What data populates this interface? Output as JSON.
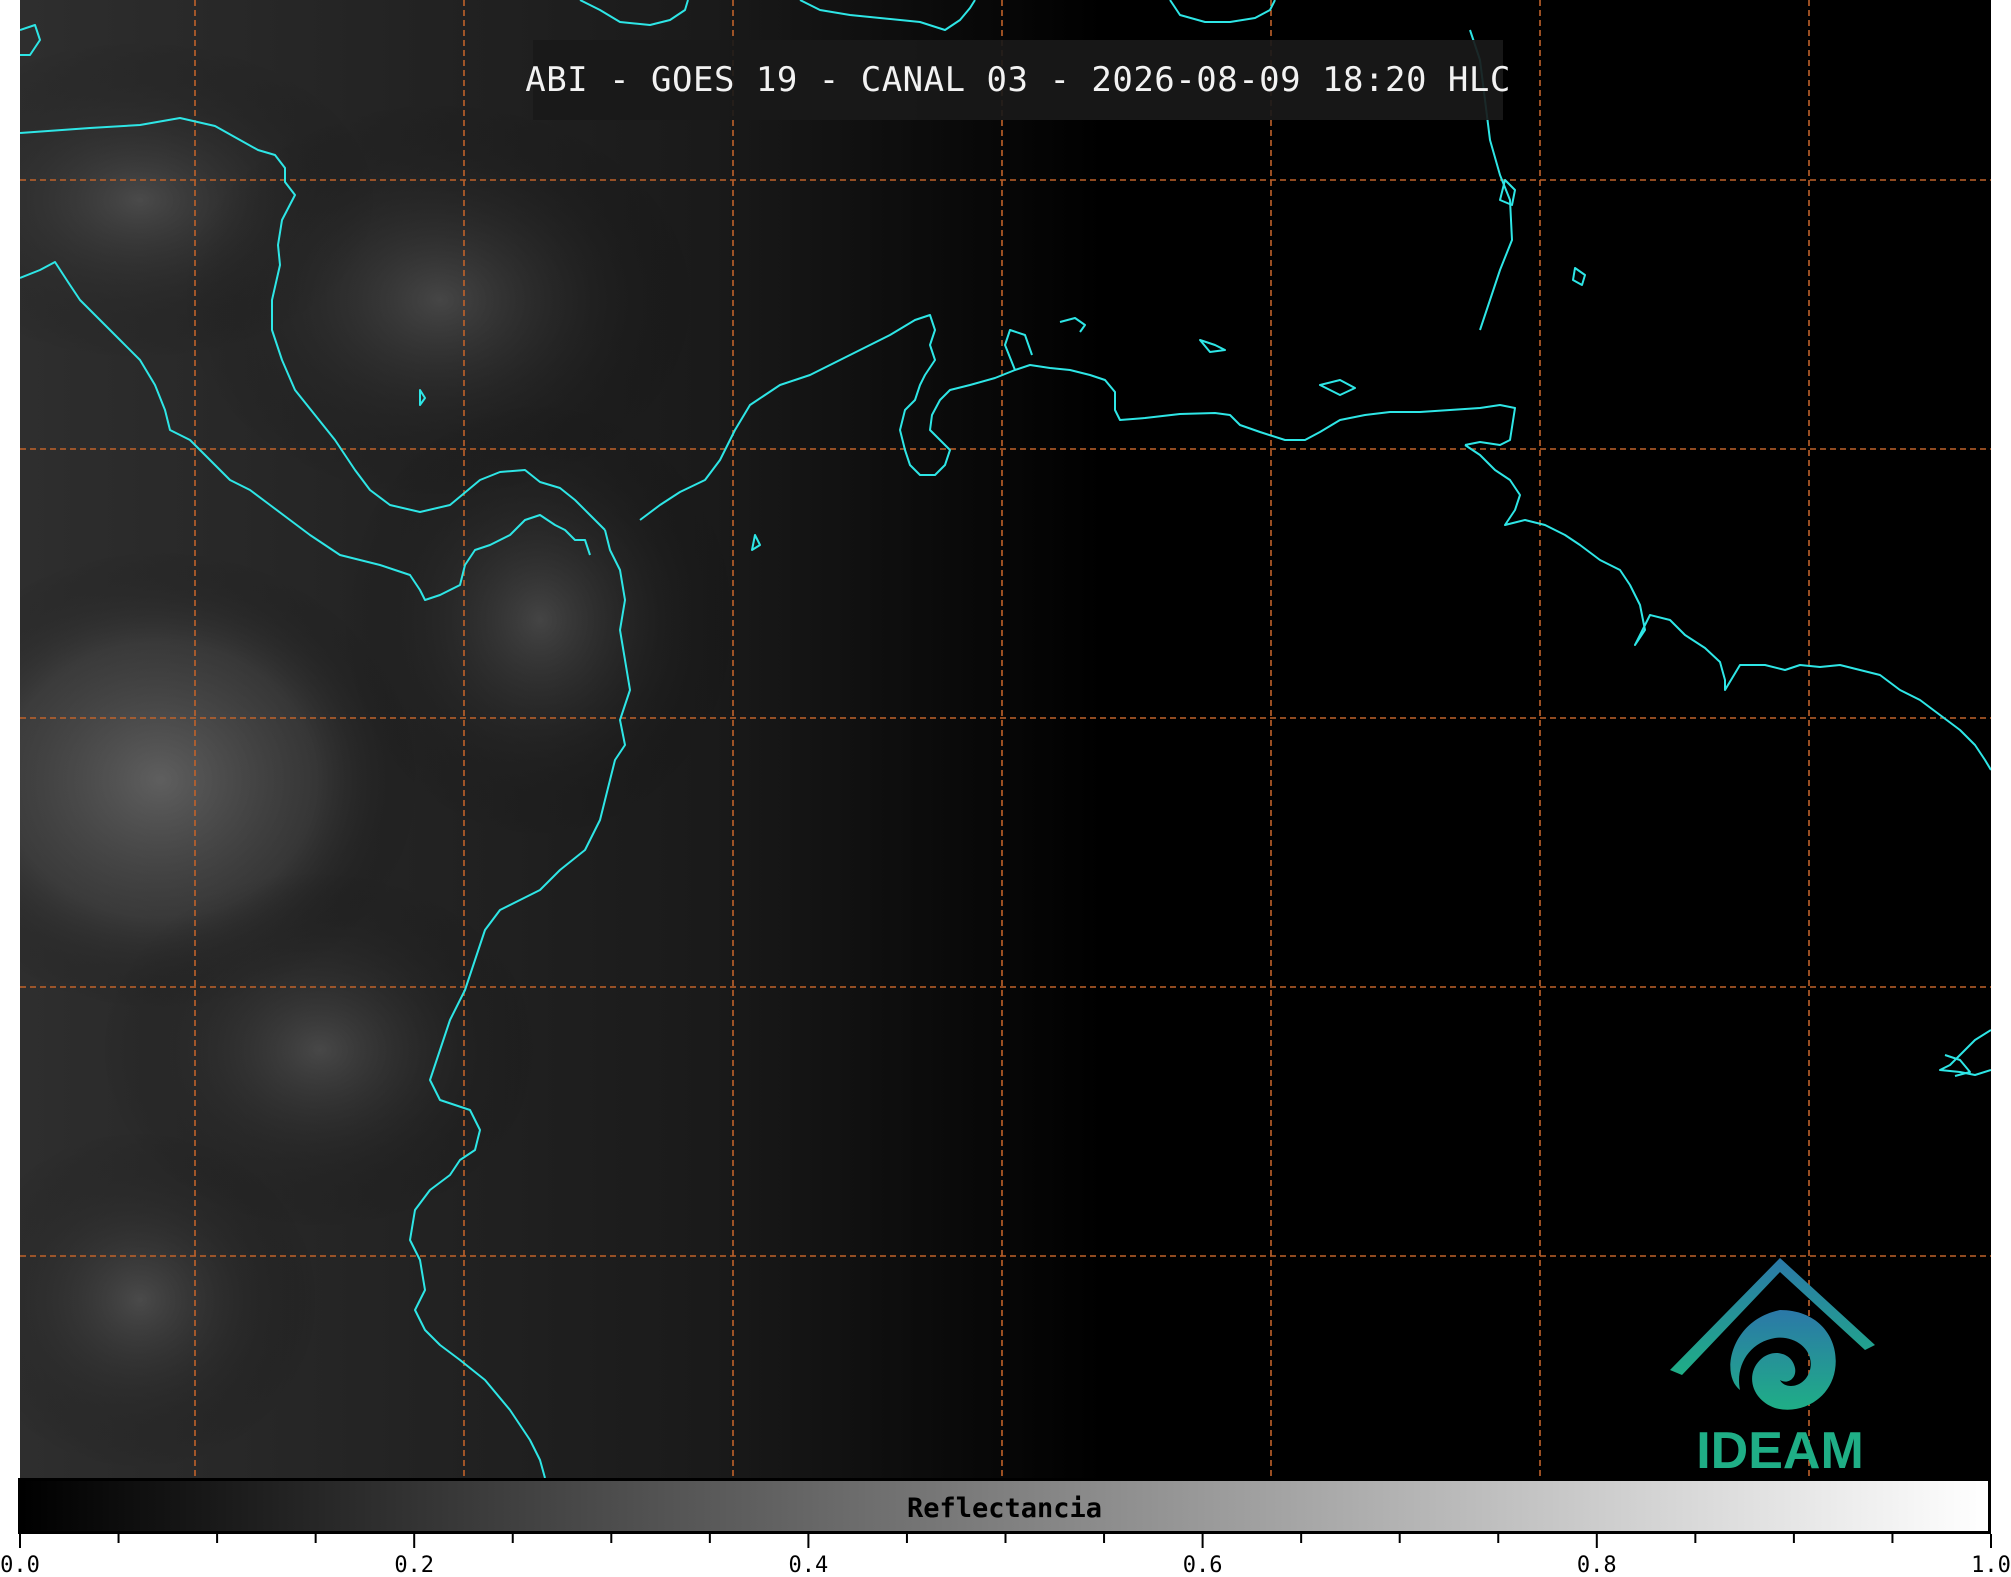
{
  "title": "ABI - GOES 19 - CANAL 03 - 2026-08-09 18:20 HLC",
  "colorbar": {
    "label": "Reflectancia",
    "min": 0.0,
    "max": 1.0,
    "tick_labels": [
      "0.0",
      "0.2",
      "0.4",
      "0.6",
      "0.8",
      "1.0"
    ],
    "minor_ticks_per_major": 4,
    "colormap": "gray"
  },
  "logo": {
    "text": "IDEAM",
    "icon": "ideam-mountain-spiral-icon"
  },
  "colors": {
    "coastline": "#2ee6e6",
    "graticule": "#c0622a",
    "background": "#000000",
    "logo_blue": "#2b78a8",
    "logo_green": "#1fae86"
  },
  "map": {
    "graticule": "dashed",
    "coastlines": true
  }
}
